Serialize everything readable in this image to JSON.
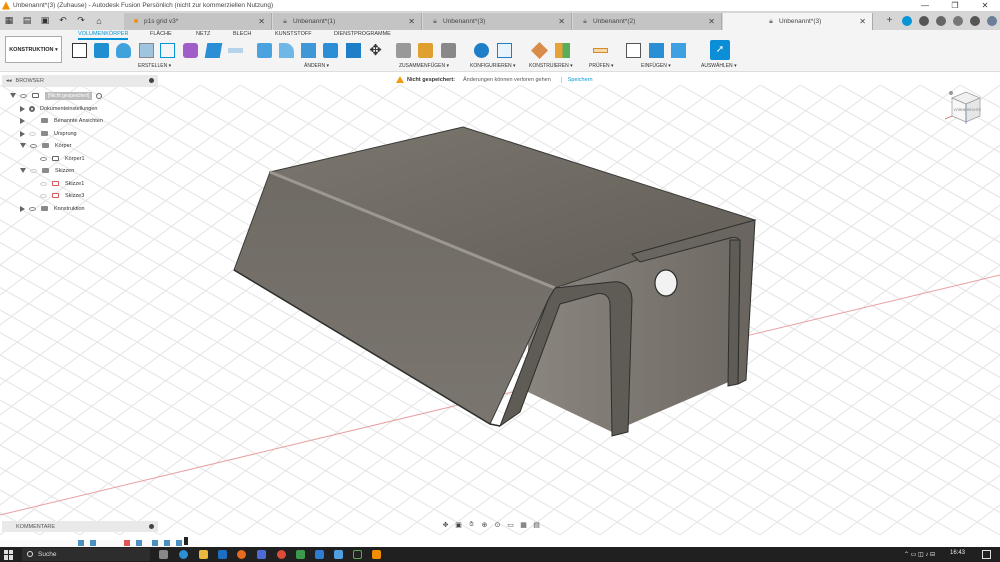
{
  "window": {
    "title": "Unbenannt*(3) (Zuhause) - Autodesk Fusion Persönlich (nicht zur kommerziellen Nutzung)",
    "controls": [
      "—",
      "❐",
      "✕"
    ]
  },
  "tabs": [
    {
      "label": "p1s grid v3*"
    },
    {
      "label": "Unbenannt*(1)"
    },
    {
      "label": "Unbenannt*(3)"
    },
    {
      "label": "Unbenannt*(2)"
    },
    {
      "label": "Unbenannt*(3)"
    }
  ],
  "toolbar": {
    "workspace": "KONSTRUKTION",
    "workspace_tabs": [
      "VOLUMENKÖRPER",
      "FLÄCHE",
      "NETZ",
      "BLECH",
      "KUNSTSTOFF",
      "DIENSTPROGRAMME"
    ],
    "groups": [
      "ERSTELLEN",
      "ÄNDERN",
      "ZUSAMMENFÜGEN",
      "KONFIGURIEREN",
      "KONSTRUIEREN",
      "PRÜFEN",
      "EINFÜGEN",
      "AUSWÄHLEN"
    ]
  },
  "notice": {
    "status": "Nicht gespeichert:",
    "message": "Änderungen können verloren gehen",
    "action": "Speichern"
  },
  "browser": {
    "header": "BROWSER",
    "root_badge": "[Nicht gespeichert]",
    "items": [
      {
        "label": "Dokumenteinstellungen"
      },
      {
        "label": "Benannte Ansichten"
      },
      {
        "label": "Ursprung"
      },
      {
        "label": "Körper"
      },
      {
        "label": "Körper1"
      },
      {
        "label": "Skizzen"
      },
      {
        "label": "Skizze1"
      },
      {
        "label": "Skizze3"
      },
      {
        "label": "Konstruktion"
      }
    ]
  },
  "viewcube": {
    "face_front": "VORNE",
    "face_right": "RECHTS"
  },
  "comments": {
    "label": "KOMMENTARE"
  },
  "taskbar": {
    "search_placeholder": "Suche",
    "time": "16:43"
  },
  "colors": {
    "accent": "#0696d7",
    "taskbar": "#202020",
    "model": "#6b6760"
  }
}
